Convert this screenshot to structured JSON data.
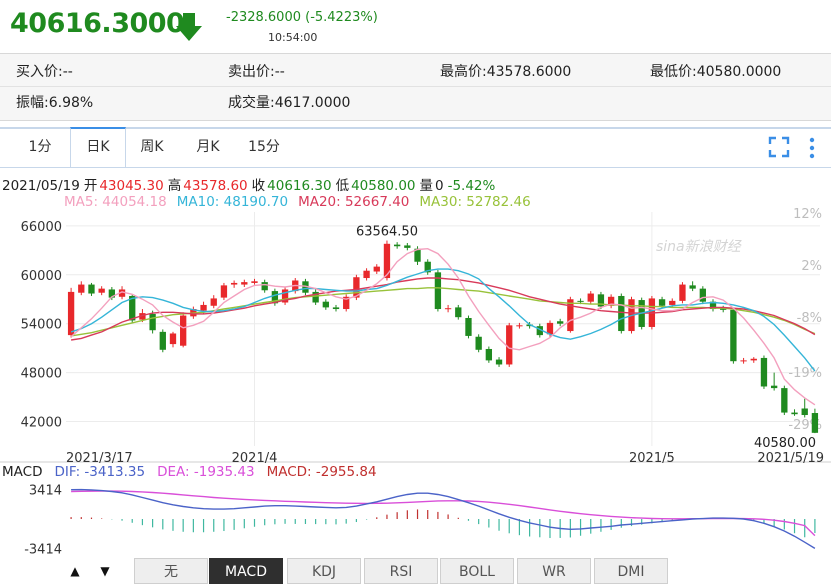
{
  "quote": {
    "price": "40616.3000",
    "change": "-2328.6000 (-5.4223%)",
    "time": "10:54:00"
  },
  "info": {
    "bid": "买入价:--",
    "ask": "卖出价:--",
    "high": "最高价:43578.6000",
    "low": "最低价:40580.0000",
    "amplitude": "振幅:6.98%",
    "volume": "成交量:4617.0000"
  },
  "tabs": [
    "1分",
    "日K",
    "周K",
    "月K",
    "15分"
  ],
  "active_tab": "日K",
  "ohlc_line": {
    "date": "2021/05/19",
    "open_label": "开",
    "open": "43045.30",
    "high_label": "高",
    "high": "43578.60",
    "close_label": "收",
    "close": "40616.30",
    "low_label": "低",
    "low": "40580.00",
    "vol_label": "量",
    "vol": "0",
    "pct": "-5.42%"
  },
  "ma_line": {
    "ma5": "MA5: 44054.18",
    "ma10": "MA10: 48190.70",
    "ma20": "MA20: 52667.40",
    "ma30": "MA30: 52782.46"
  },
  "watermark": "sina新浪财经",
  "colors": {
    "up": "#e8282b",
    "down": "#1f8a1f",
    "ma5": "#f3a0be",
    "ma10": "#35b5d8",
    "ma20": "#d83a5a",
    "ma30": "#98c23a",
    "dif": "#4b63c8",
    "dea": "#d94fd9",
    "macd": "#c0302f"
  },
  "macd_legend": {
    "label": "MACD",
    "dif": "DIF: -3413.35",
    "dea": "DEA: -1935.43",
    "macd": "MACD: -2955.84"
  },
  "bottom_tabs": [
    "无",
    "MACD",
    "KDJ",
    "RSI",
    "BOLL",
    "WR",
    "DMI"
  ],
  "bottom_active": "MACD",
  "chart_data": {
    "type": "candlestick",
    "price_ticks": [
      "66000",
      "60000",
      "54000",
      "48000",
      "42000"
    ],
    "price_ylim": [
      39000,
      67700
    ],
    "pct_ticks": [
      "12%",
      "2%",
      "-8%",
      "-19%",
      "-29%"
    ],
    "date_ticks": [
      "2021/3/17",
      "2021/4",
      "2021/5",
      "2021/5/19"
    ],
    "annotations": {
      "max_label": "63564.50",
      "min_label": "40580.00"
    },
    "macd_ticks": [
      "3414",
      "-3414"
    ],
    "macd_ylim": [
      -4300,
      4300
    ],
    "candles": [
      {
        "o": 52600,
        "c": 57900,
        "h": 58400,
        "l": 52300
      },
      {
        "o": 57800,
        "c": 58800,
        "h": 59200,
        "l": 57500
      },
      {
        "o": 58800,
        "c": 57700,
        "h": 59000,
        "l": 57400
      },
      {
        "o": 57800,
        "c": 58300,
        "h": 58600,
        "l": 57500
      },
      {
        "o": 58200,
        "c": 57200,
        "h": 58500,
        "l": 56900
      },
      {
        "o": 57300,
        "c": 58200,
        "h": 58600,
        "l": 57000
      },
      {
        "o": 57400,
        "c": 54400,
        "h": 57600,
        "l": 54100
      },
      {
        "o": 54500,
        "c": 55300,
        "h": 55800,
        "l": 54200
      },
      {
        "o": 55200,
        "c": 53200,
        "h": 55600,
        "l": 52800
      },
      {
        "o": 53000,
        "c": 50800,
        "h": 53300,
        "l": 50500
      },
      {
        "o": 51500,
        "c": 52800,
        "h": 53000,
        "l": 51100
      },
      {
        "o": 51300,
        "c": 55000,
        "h": 55400,
        "l": 51100
      },
      {
        "o": 54900,
        "c": 55800,
        "h": 56100,
        "l": 54600
      },
      {
        "o": 55600,
        "c": 56300,
        "h": 56700,
        "l": 55200
      },
      {
        "o": 56200,
        "c": 57100,
        "h": 57500,
        "l": 55900
      },
      {
        "o": 57200,
        "c": 58700,
        "h": 59000,
        "l": 56900
      },
      {
        "o": 58800,
        "c": 59000,
        "h": 59300,
        "l": 58400
      },
      {
        "o": 58800,
        "c": 59100,
        "h": 59400,
        "l": 58500
      },
      {
        "o": 59000,
        "c": 59200,
        "h": 59500,
        "l": 58800
      },
      {
        "o": 59100,
        "c": 58100,
        "h": 59400,
        "l": 57800
      },
      {
        "o": 58000,
        "c": 56500,
        "h": 58300,
        "l": 56200
      },
      {
        "o": 56600,
        "c": 58200,
        "h": 58500,
        "l": 56300
      },
      {
        "o": 58000,
        "c": 59300,
        "h": 59600,
        "l": 57700
      },
      {
        "o": 59200,
        "c": 57800,
        "h": 59500,
        "l": 57500
      },
      {
        "o": 57900,
        "c": 56600,
        "h": 58200,
        "l": 56300
      },
      {
        "o": 56700,
        "c": 56000,
        "h": 57000,
        "l": 55700
      },
      {
        "o": 56000,
        "c": 55800,
        "h": 56300,
        "l": 55500
      },
      {
        "o": 55800,
        "c": 57300,
        "h": 57600,
        "l": 55500
      },
      {
        "o": 57200,
        "c": 59700,
        "h": 60000,
        "l": 56900
      },
      {
        "o": 59600,
        "c": 60500,
        "h": 60800,
        "l": 59300
      },
      {
        "o": 60400,
        "c": 61000,
        "h": 61300,
        "l": 60100
      },
      {
        "o": 59600,
        "c": 63800,
        "h": 64200,
        "l": 59300
      },
      {
        "o": 63700,
        "c": 63500,
        "h": 64000,
        "l": 63200
      },
      {
        "o": 63600,
        "c": 63300,
        "h": 63900,
        "l": 63000
      },
      {
        "o": 63200,
        "c": 61600,
        "h": 63500,
        "l": 61200
      },
      {
        "o": 61600,
        "c": 60300,
        "h": 61900,
        "l": 60000
      },
      {
        "o": 60300,
        "c": 55800,
        "h": 60600,
        "l": 55500
      },
      {
        "o": 55800,
        "c": 55900,
        "h": 56300,
        "l": 55400
      },
      {
        "o": 56000,
        "c": 54800,
        "h": 56300,
        "l": 54500
      },
      {
        "o": 54700,
        "c": 52500,
        "h": 55000,
        "l": 52200
      },
      {
        "o": 52400,
        "c": 50800,
        "h": 52700,
        "l": 50500
      },
      {
        "o": 50900,
        "c": 49500,
        "h": 51200,
        "l": 49200
      },
      {
        "o": 49600,
        "c": 49000,
        "h": 49900,
        "l": 48700
      },
      {
        "o": 49000,
        "c": 53800,
        "h": 54100,
        "l": 48700
      },
      {
        "o": 53700,
        "c": 53800,
        "h": 54100,
        "l": 53400
      },
      {
        "o": 53900,
        "c": 53700,
        "h": 54200,
        "l": 53400
      },
      {
        "o": 53700,
        "c": 52600,
        "h": 54000,
        "l": 52300
      },
      {
        "o": 52700,
        "c": 54100,
        "h": 54400,
        "l": 52400
      },
      {
        "o": 54300,
        "c": 54000,
        "h": 54600,
        "l": 53700
      },
      {
        "o": 53100,
        "c": 57000,
        "h": 57300,
        "l": 52900
      },
      {
        "o": 56800,
        "c": 56700,
        "h": 57100,
        "l": 56400
      },
      {
        "o": 56700,
        "c": 57700,
        "h": 58000,
        "l": 56400
      },
      {
        "o": 57600,
        "c": 56100,
        "h": 57900,
        "l": 55800
      },
      {
        "o": 56200,
        "c": 57300,
        "h": 57600,
        "l": 55900
      },
      {
        "o": 57400,
        "c": 53100,
        "h": 57700,
        "l": 52800
      },
      {
        "o": 53100,
        "c": 57000,
        "h": 57300,
        "l": 52800
      },
      {
        "o": 56900,
        "c": 53600,
        "h": 57200,
        "l": 53300
      },
      {
        "o": 53600,
        "c": 57100,
        "h": 57400,
        "l": 53300
      },
      {
        "o": 57000,
        "c": 56200,
        "h": 57300,
        "l": 55900
      },
      {
        "o": 56300,
        "c": 56800,
        "h": 57100,
        "l": 56000
      },
      {
        "o": 56800,
        "c": 58800,
        "h": 59100,
        "l": 56500
      },
      {
        "o": 58700,
        "c": 58300,
        "h": 59200,
        "l": 58000
      },
      {
        "o": 58300,
        "c": 56700,
        "h": 58600,
        "l": 56400
      },
      {
        "o": 56700,
        "c": 55800,
        "h": 57000,
        "l": 55500
      },
      {
        "o": 55900,
        "c": 55700,
        "h": 56200,
        "l": 55400
      },
      {
        "o": 55700,
        "c": 49400,
        "h": 56000,
        "l": 49100
      },
      {
        "o": 49400,
        "c": 49500,
        "h": 49800,
        "l": 49100
      },
      {
        "o": 49500,
        "c": 49700,
        "h": 49900,
        "l": 49200
      },
      {
        "o": 49800,
        "c": 46300,
        "h": 50100,
        "l": 46000
      },
      {
        "o": 46400,
        "c": 46100,
        "h": 48000,
        "l": 45800
      },
      {
        "o": 46100,
        "c": 43100,
        "h": 46400,
        "l": 42800
      },
      {
        "o": 43100,
        "c": 42900,
        "h": 43500,
        "l": 42700
      },
      {
        "o": 43600,
        "c": 42800,
        "h": 44800,
        "l": 42500
      },
      {
        "o": 43045,
        "c": 40616,
        "h": 43578,
        "l": 40580
      }
    ],
    "ma5": [
      52400,
      53500,
      54600,
      55900,
      57300,
      57900,
      57600,
      57000,
      56300,
      55000,
      54200,
      53500,
      53800,
      54300,
      55400,
      56600,
      57400,
      58200,
      58700,
      58800,
      58600,
      58500,
      58700,
      58600,
      58300,
      57800,
      57300,
      57000,
      57400,
      58100,
      58900,
      60000,
      61600,
      62600,
      63100,
      63200,
      62600,
      61300,
      59600,
      57400,
      55500,
      53800,
      52200,
      51000,
      50800,
      51200,
      51600,
      52300,
      53500,
      54400,
      54800,
      55300,
      56000,
      56400,
      56300,
      55900,
      56000,
      55800,
      55600,
      55600,
      55800,
      56600,
      57200,
      57300,
      56900,
      55900,
      54700,
      53200,
      51600,
      49800,
      47200,
      45900,
      44900,
      44054
    ],
    "ma10": [
      53000,
      53400,
      54000,
      54800,
      55700,
      56600,
      57100,
      57300,
      57200,
      56900,
      56500,
      56000,
      55700,
      55500,
      55500,
      55600,
      55800,
      56100,
      56600,
      57100,
      57500,
      57800,
      58100,
      58300,
      58300,
      58200,
      58100,
      58000,
      58000,
      58200,
      58300,
      58700,
      59200,
      59700,
      60100,
      60500,
      60700,
      60700,
      60500,
      60100,
      59500,
      58300,
      57300,
      56200,
      55000,
      53900,
      53300,
      52700,
      52300,
      52100,
      52400,
      52800,
      53300,
      53900,
      54600,
      55000,
      55300,
      55600,
      55900,
      56200,
      56300,
      56300,
      56500,
      56600,
      56500,
      56300,
      56000,
      55600,
      54900,
      53900,
      52600,
      51200,
      49800,
      48190
    ],
    "ma20": [
      52000,
      52200,
      52600,
      53000,
      53600,
      54200,
      54600,
      55000,
      55300,
      55400,
      55400,
      55300,
      55200,
      55200,
      55300,
      55500,
      55700,
      55900,
      56200,
      56400,
      56600,
      56900,
      57100,
      57400,
      57600,
      57800,
      58000,
      58100,
      58200,
      58400,
      58600,
      58800,
      59100,
      59300,
      59500,
      59600,
      59600,
      59500,
      59400,
      59200,
      59000,
      58700,
      58400,
      58100,
      57700,
      57300,
      57000,
      56700,
      56400,
      56200,
      56000,
      55800,
      55600,
      55500,
      55400,
      55300,
      55300,
      55300,
      55400,
      55500,
      55700,
      55800,
      55900,
      56000,
      56000,
      55900,
      55800,
      55600,
      55300,
      55000,
      54500,
      54000,
      53400,
      52667
    ],
    "ma30": [
      52500,
      52700,
      52900,
      53200,
      53500,
      53800,
      54100,
      54400,
      54700,
      54900,
      55100,
      55200,
      55300,
      55400,
      55600,
      55800,
      56000,
      56200,
      56400,
      56600,
      56800,
      57000,
      57200,
      57300,
      57400,
      57500,
      57600,
      57700,
      57800,
      57900,
      58000,
      58100,
      58200,
      58300,
      58300,
      58400,
      58400,
      58300,
      58200,
      58100,
      58000,
      57800,
      57600,
      57400,
      57200,
      57000,
      56800,
      56700,
      56600,
      56500,
      56500,
      56400,
      56400,
      56300,
      56300,
      56200,
      56200,
      56100,
      56100,
      56000,
      56000,
      56000,
      56000,
      55900,
      55900,
      55800,
      55600,
      55400,
      55100,
      54800,
      54400,
      53900,
      53300,
      52782
    ],
    "dif": [
      3400,
      3420,
      3380,
      3300,
      3200,
      3050,
      2800,
      2500,
      2200,
      1900,
      1650,
      1450,
      1300,
      1200,
      1150,
      1150,
      1200,
      1300,
      1400,
      1500,
      1550,
      1550,
      1500,
      1450,
      1400,
      1350,
      1300,
      1350,
      1500,
      1750,
      2000,
      2300,
      2600,
      2850,
      3000,
      3000,
      2850,
      2600,
      2250,
      1900,
      1500,
      1050,
      600,
      200,
      -150,
      -450,
      -700,
      -950,
      -1100,
      -1200,
      -1150,
      -1050,
      -950,
      -850,
      -700,
      -600,
      -500,
      -400,
      -300,
      -200,
      -100,
      0,
      50,
      100,
      100,
      80,
      0,
      -200,
      -500,
      -900,
      -1400,
      -2000,
      -2700,
      -3413
    ],
    "dea": [
      3200,
      3220,
      3230,
      3240,
      3240,
      3230,
      3200,
      3150,
      3080,
      3000,
      2900,
      2800,
      2700,
      2600,
      2500,
      2420,
      2350,
      2280,
      2220,
      2160,
      2110,
      2060,
      2020,
      1980,
      1940,
      1900,
      1870,
      1840,
      1820,
      1810,
      1820,
      1840,
      1880,
      1930,
      1990,
      2050,
      2100,
      2120,
      2120,
      2090,
      2040,
      1950,
      1840,
      1710,
      1560,
      1400,
      1230,
      1060,
      900,
      750,
      620,
      500,
      400,
      300,
      220,
      150,
      100,
      60,
      30,
      20,
      20,
      30,
      40,
      50,
      60,
      60,
      50,
      20,
      -40,
      -140,
      -290,
      -500,
      -770,
      -1935
    ],
    "macd": [
      400,
      400,
      300,
      120,
      -80,
      -360,
      -800,
      -1300,
      -1760,
      -2200,
      -2500,
      -2700,
      -2800,
      -2800,
      -2700,
      -2540,
      -2300,
      -1960,
      -1640,
      -1320,
      -1120,
      -1020,
      -1040,
      -1060,
      -1080,
      -1100,
      -1140,
      -980,
      -640,
      -120,
      360,
      920,
      1440,
      1840,
      2020,
      1900,
      1500,
      960,
      260,
      -380,
      -1080,
      -1800,
      -2480,
      -3020,
      -3420,
      -3700,
      -3860,
      -4020,
      -4000,
      -3900,
      -3540,
      -3100,
      -2700,
      -2300,
      -1840,
      -1500,
      -1200,
      -920,
      -660,
      -440,
      -240,
      -60,
      20,
      100,
      80,
      40,
      -100,
      -440,
      -920,
      -1520,
      -2220,
      -3000,
      -3860,
      -2956
    ]
  }
}
